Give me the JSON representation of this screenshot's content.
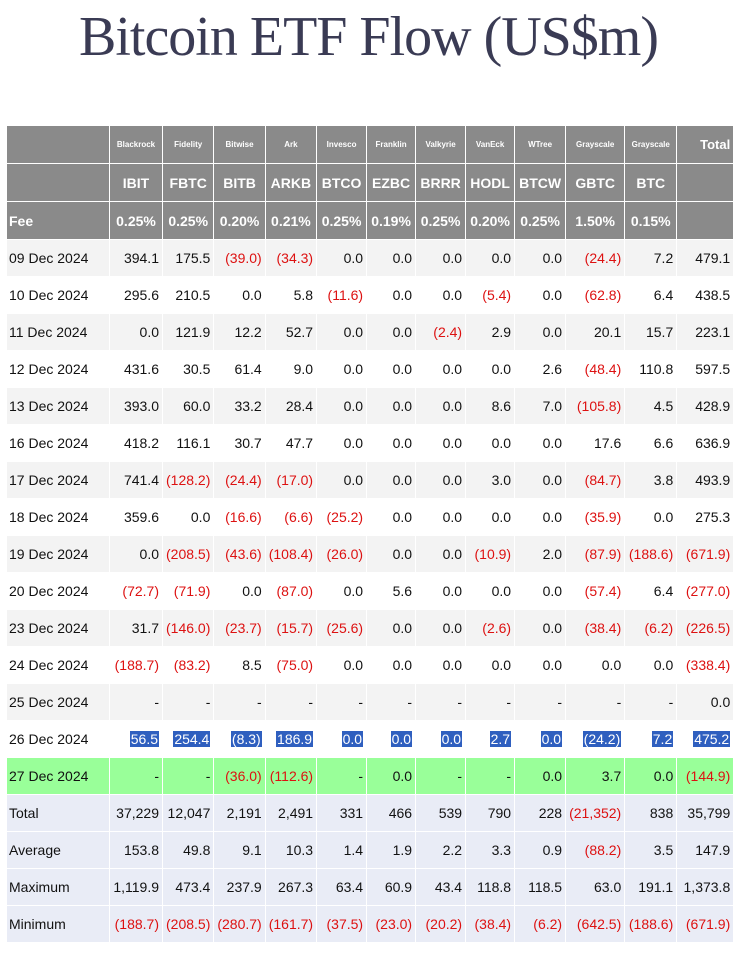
{
  "title": "Bitcoin ETF Flow (US$m)",
  "issuers": [
    "Blackrock",
    "Fidelity",
    "Bitwise",
    "Ark",
    "Invesco",
    "Franklin",
    "Valkyrie",
    "VanEck",
    "WTree",
    "Grayscale",
    "Grayscale"
  ],
  "total_label": "Total",
  "tickers": [
    "IBIT",
    "FBTC",
    "BITB",
    "ARKB",
    "BTCO",
    "EZBC",
    "BRRR",
    "HODL",
    "BTCW",
    "GBTC",
    "BTC"
  ],
  "fee_label": "Fee",
  "fees": [
    "0.25%",
    "0.25%",
    "0.20%",
    "0.21%",
    "0.25%",
    "0.19%",
    "0.25%",
    "0.20%",
    "0.25%",
    "1.50%",
    "0.15%"
  ],
  "rows": [
    {
      "date": "09 Dec 2024",
      "values": [
        "394.1",
        "175.5",
        "(39.0)",
        "(34.3)",
        "0.0",
        "0.0",
        "0.0",
        "0.0",
        "0.0",
        "(24.4)",
        "7.2",
        "479.1"
      ]
    },
    {
      "date": "10 Dec 2024",
      "values": [
        "295.6",
        "210.5",
        "0.0",
        "5.8",
        "(11.6)",
        "0.0",
        "0.0",
        "(5.4)",
        "0.0",
        "(62.8)",
        "6.4",
        "438.5"
      ]
    },
    {
      "date": "11 Dec 2024",
      "values": [
        "0.0",
        "121.9",
        "12.2",
        "52.7",
        "0.0",
        "0.0",
        "(2.4)",
        "2.9",
        "0.0",
        "20.1",
        "15.7",
        "223.1"
      ]
    },
    {
      "date": "12 Dec 2024",
      "values": [
        "431.6",
        "30.5",
        "61.4",
        "9.0",
        "0.0",
        "0.0",
        "0.0",
        "0.0",
        "2.6",
        "(48.4)",
        "110.8",
        "597.5"
      ]
    },
    {
      "date": "13 Dec 2024",
      "values": [
        "393.0",
        "60.0",
        "33.2",
        "28.4",
        "0.0",
        "0.0",
        "0.0",
        "8.6",
        "7.0",
        "(105.8)",
        "4.5",
        "428.9"
      ]
    },
    {
      "date": "16 Dec 2024",
      "values": [
        "418.2",
        "116.1",
        "30.7",
        "47.7",
        "0.0",
        "0.0",
        "0.0",
        "0.0",
        "0.0",
        "17.6",
        "6.6",
        "636.9"
      ]
    },
    {
      "date": "17 Dec 2024",
      "values": [
        "741.4",
        "(128.2)",
        "(24.4)",
        "(17.0)",
        "0.0",
        "0.0",
        "0.0",
        "3.0",
        "0.0",
        "(84.7)",
        "3.8",
        "493.9"
      ]
    },
    {
      "date": "18 Dec 2024",
      "values": [
        "359.6",
        "0.0",
        "(16.6)",
        "(6.6)",
        "(25.2)",
        "0.0",
        "0.0",
        "0.0",
        "0.0",
        "(35.9)",
        "0.0",
        "275.3"
      ]
    },
    {
      "date": "19 Dec 2024",
      "values": [
        "0.0",
        "(208.5)",
        "(43.6)",
        "(108.4)",
        "(26.0)",
        "0.0",
        "0.0",
        "(10.9)",
        "2.0",
        "(87.9)",
        "(188.6)",
        "(671.9)"
      ]
    },
    {
      "date": "20 Dec 2024",
      "values": [
        "(72.7)",
        "(71.9)",
        "0.0",
        "(87.0)",
        "0.0",
        "5.6",
        "0.0",
        "0.0",
        "0.0",
        "(57.4)",
        "6.4",
        "(277.0)"
      ]
    },
    {
      "date": "23 Dec 2024",
      "values": [
        "31.7",
        "(146.0)",
        "(23.7)",
        "(15.7)",
        "(25.6)",
        "0.0",
        "0.0",
        "(2.6)",
        "0.0",
        "(38.4)",
        "(6.2)",
        "(226.5)"
      ]
    },
    {
      "date": "24 Dec 2024",
      "values": [
        "(188.7)",
        "(83.2)",
        "8.5",
        "(75.0)",
        "0.0",
        "0.0",
        "0.0",
        "0.0",
        "0.0",
        "0.0",
        "0.0",
        "(338.4)"
      ]
    },
    {
      "date": "25 Dec 2024",
      "values": [
        "-",
        "-",
        "-",
        "-",
        "-",
        "-",
        "-",
        "-",
        "-",
        "-",
        "-",
        "0.0"
      ]
    },
    {
      "date": "26 Dec 2024",
      "values": [
        "56.5",
        "254.4",
        "(8.3)",
        "186.9",
        "0.0",
        "0.0",
        "0.0",
        "2.7",
        "0.0",
        "(24.2)",
        "7.2",
        "475.2"
      ],
      "highlight": true
    },
    {
      "date": "27 Dec 2024",
      "values": [
        "-",
        "-",
        "(36.0)",
        "(112.6)",
        "-",
        "0.0",
        "-",
        "-",
        "0.0",
        "3.7",
        "0.0",
        "(144.9)"
      ],
      "green": true
    }
  ],
  "stats": [
    {
      "label": "Total",
      "values": [
        "37,229",
        "12,047",
        "2,191",
        "2,491",
        "331",
        "466",
        "539",
        "790",
        "228",
        "(21,352)",
        "838",
        "35,799"
      ]
    },
    {
      "label": "Average",
      "values": [
        "153.8",
        "49.8",
        "9.1",
        "10.3",
        "1.4",
        "1.9",
        "2.2",
        "3.3",
        "0.9",
        "(88.2)",
        "3.5",
        "147.9"
      ]
    },
    {
      "label": "Maximum",
      "values": [
        "1,119.9",
        "473.4",
        "237.9",
        "267.3",
        "63.4",
        "60.9",
        "43.4",
        "118.8",
        "118.5",
        "63.0",
        "191.1",
        "1,373.8"
      ]
    },
    {
      "label": "Minimum",
      "values": [
        "(188.7)",
        "(208.5)",
        "(280.7)",
        "(161.7)",
        "(37.5)",
        "(23.0)",
        "(20.2)",
        "(38.4)",
        "(6.2)",
        "(642.5)",
        "(188.6)",
        "(671.9)"
      ]
    }
  ],
  "colors": {
    "header_bg": "#8a8a8a",
    "negative": "#dd1111",
    "highlight": "#2f5fbf",
    "latest_row": "#99ff99",
    "stats_bg": "#e9ecf6",
    "title": "#3a3b54"
  }
}
